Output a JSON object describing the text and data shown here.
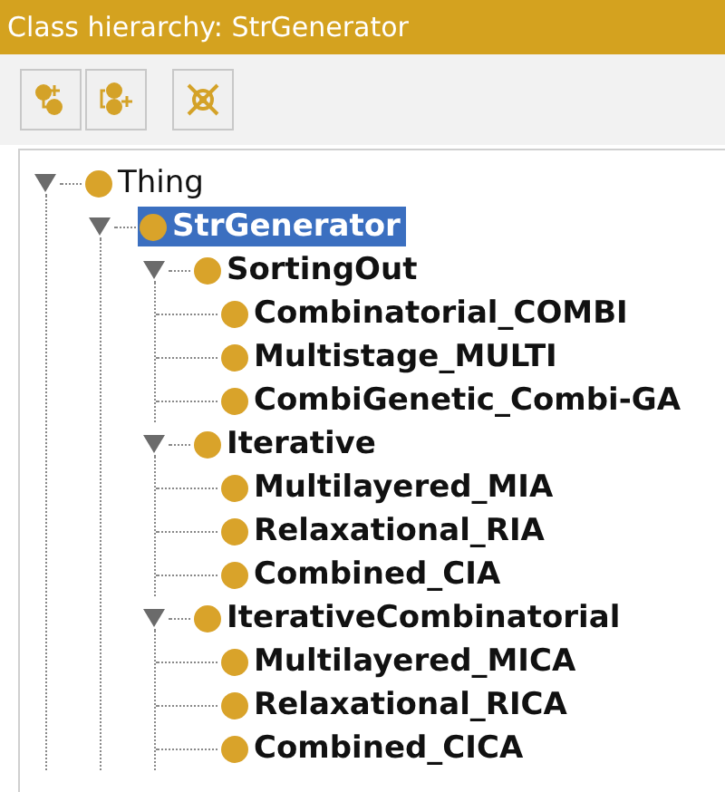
{
  "panel": {
    "title": "Class hierarchy: StrGenerator"
  },
  "toolbar": [
    {
      "kind": "add-subclass"
    },
    {
      "kind": "add-sibling"
    },
    {
      "kind": "delete"
    }
  ],
  "tree": [
    {
      "label": "Thing",
      "bold": false,
      "selected": false,
      "expanded": true,
      "children": [
        {
          "label": "StrGenerator",
          "bold": true,
          "selected": true,
          "expanded": true,
          "children": [
            {
              "label": "SortingOut",
              "bold": true,
              "selected": false,
              "expanded": true,
              "children": [
                {
                  "label": "Combinatorial_COMBI",
                  "bold": true,
                  "selected": false
                },
                {
                  "label": "Multistage_MULTI",
                  "bold": true,
                  "selected": false
                },
                {
                  "label": "CombiGenetic_Combi-GA",
                  "bold": true,
                  "selected": false
                }
              ]
            },
            {
              "label": "Iterative",
              "bold": true,
              "selected": false,
              "expanded": true,
              "children": [
                {
                  "label": "Multilayered_MIA",
                  "bold": true,
                  "selected": false
                },
                {
                  "label": "Relaxational_RIA",
                  "bold": true,
                  "selected": false
                },
                {
                  "label": "Combined_CIA",
                  "bold": true,
                  "selected": false
                }
              ]
            },
            {
              "label": "IterativeCombinatorial",
              "bold": true,
              "selected": false,
              "expanded": true,
              "children": [
                {
                  "label": "Multilayered_MICA",
                  "bold": true,
                  "selected": false
                },
                {
                  "label": "Relaxational_RICA",
                  "bold": true,
                  "selected": false
                },
                {
                  "label": "Combined_CICA",
                  "bold": true,
                  "selected": false
                }
              ]
            }
          ]
        }
      ]
    }
  ]
}
